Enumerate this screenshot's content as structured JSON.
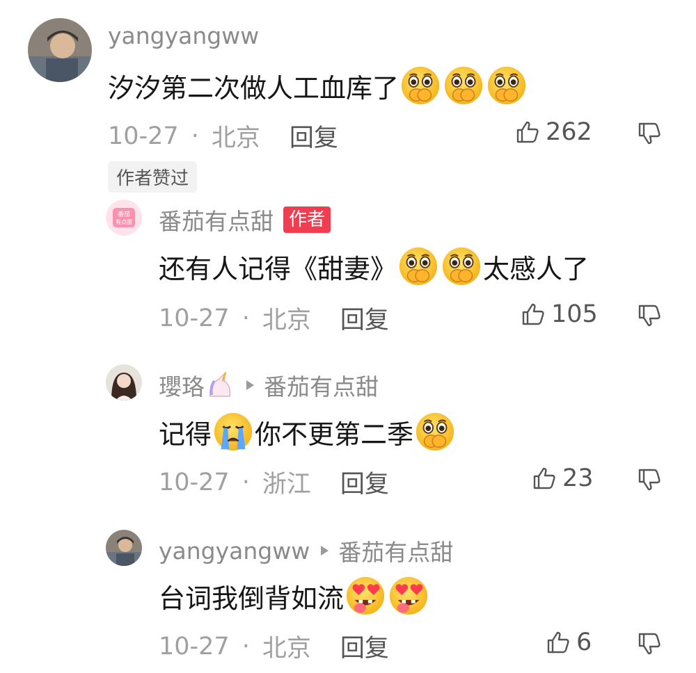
{
  "comments": [
    {
      "username": "yangyangww",
      "text_before": "汐汐第二次做人工血库了",
      "emojis": [
        "cover-mouth-face",
        "cover-mouth-face",
        "cover-mouth-face"
      ],
      "date": "10-27",
      "location": "北京",
      "reply_label": "回复",
      "likes": "262",
      "liked_by_author_tag": "作者赞过"
    },
    {
      "username": "番茄有点甜",
      "author_badge": "作者",
      "avatar_text": "番茄\n有点甜",
      "text_before": "还有人记得《甜妻》",
      "text_after": "太感人了",
      "date": "10-27",
      "location": "北京",
      "reply_label": "回复",
      "likes": "105"
    },
    {
      "username": "瓔珞",
      "reply_to": "番茄有点甜",
      "text_part1": "记得",
      "text_part2": "你不更第二季",
      "date": "10-27",
      "location": "浙江",
      "reply_label": "回复",
      "likes": "23"
    },
    {
      "username": "yangyangww",
      "reply_to": "番茄有点甜",
      "text_before": "台词我倒背如流",
      "date": "10-27",
      "location": "北京",
      "reply_label": "回复",
      "likes": "6"
    }
  ],
  "colors": {
    "meta_gray": "#a0a0a0",
    "author_badge": "#f23c4f",
    "emoji_yellow": "#ffc83d"
  }
}
